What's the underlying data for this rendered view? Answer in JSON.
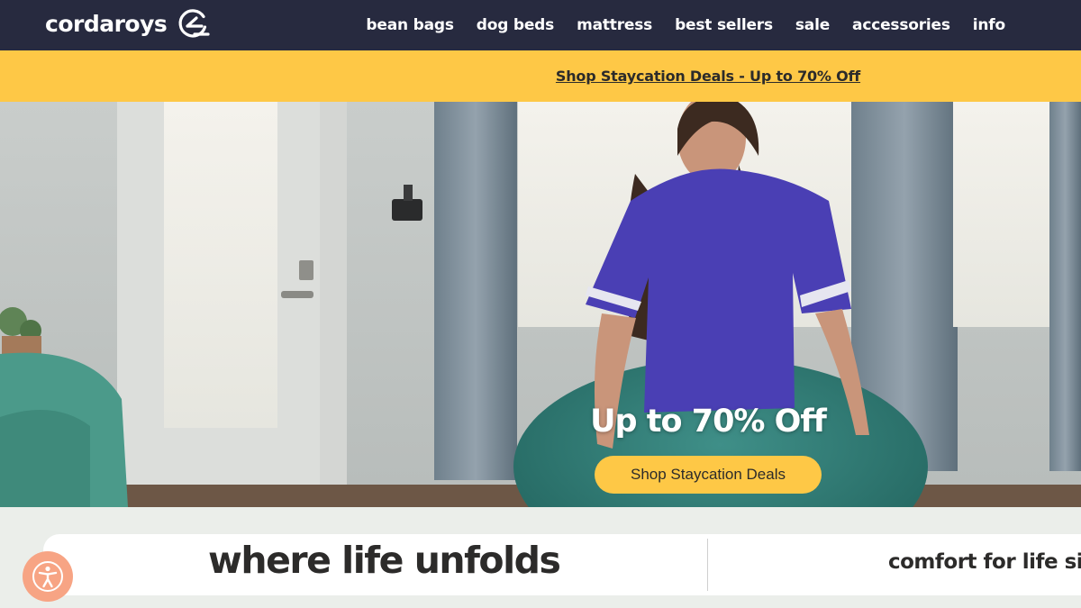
{
  "brand": {
    "name": "cordaroys",
    "logo_icon": "c-mark-logo-icon"
  },
  "nav": {
    "items": [
      {
        "label": "bean bags"
      },
      {
        "label": "dog beds"
      },
      {
        "label": "mattress"
      },
      {
        "label": "best sellers"
      },
      {
        "label": "sale"
      },
      {
        "label": "accessories"
      },
      {
        "label": "info"
      }
    ]
  },
  "promo": {
    "text": "Shop Staycation Deals - Up to 70% Off"
  },
  "hero": {
    "heading": "Up to 70% Off",
    "cta_label": "Shop Staycation Deals"
  },
  "strip": {
    "slogan_primary": "where life unfolds",
    "slogan_secondary": "comfort for life si"
  },
  "accessibility": {
    "icon": "accessibility-icon"
  },
  "colors": {
    "nav_bg": "#272a3f",
    "accent_yellow": "#fec846",
    "text_dark": "#2c2b2a",
    "accessibility_bg": "#f7a484",
    "strip_bg": "#ebeeea"
  }
}
